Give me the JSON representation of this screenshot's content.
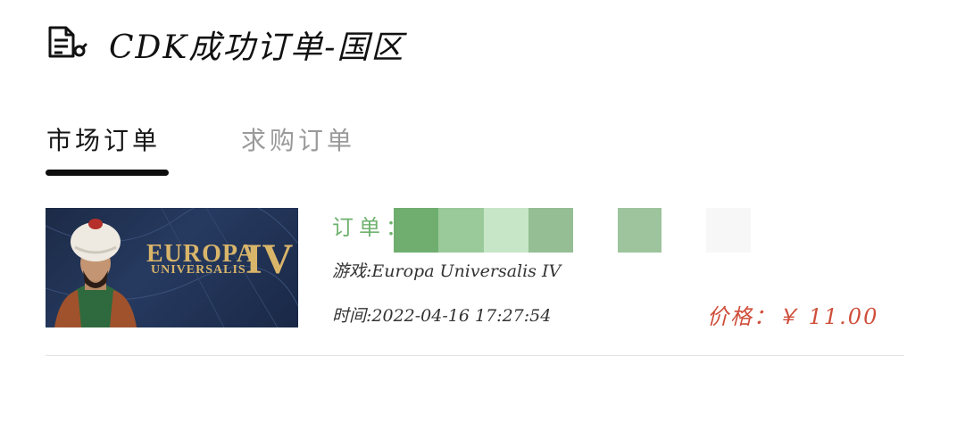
{
  "header": {
    "icon": "document-edit-icon",
    "title": "CDK成功订单-国区"
  },
  "tabs": [
    {
      "label": "市场订单",
      "active": true
    },
    {
      "label": "求购订单",
      "active": false
    }
  ],
  "order": {
    "thumbnail": {
      "title_line1": "EUROPA",
      "title_line2": "UNIVERSALIS",
      "numeral": "IV"
    },
    "order_label": "订单：",
    "order_number_redacted": true,
    "game": "游戏:Europa Universalis IV",
    "time": "时间:2022-04-16 17:27:54",
    "price": "价格：￥ 11.00"
  },
  "colors": {
    "accent_green": "#6fb26f",
    "price_red": "#cf4e3a",
    "tab_inactive": "#9a9a9a"
  }
}
